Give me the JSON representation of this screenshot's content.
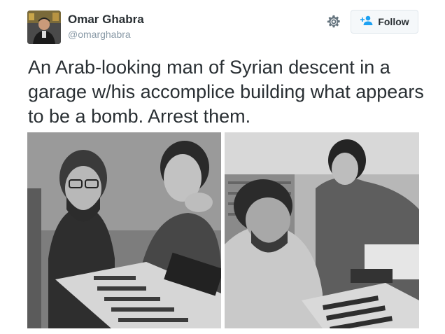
{
  "user": {
    "name": "Omar Ghabra",
    "handle": "@omarghabra"
  },
  "actions": {
    "follow_label": "Follow",
    "settings_icon": "gear-icon",
    "follow_icon": "add-user-icon"
  },
  "tweet": {
    "text": "An Arab-looking man of Syrian descent in a garage w/his accomplice building what appears to be a bomb. Arrest them."
  },
  "colors": {
    "text": "#292f33",
    "secondary": "#8899a6",
    "accent": "#1da1f2",
    "button_bg": "#f5f8fa",
    "button_border": "#e1e8ed"
  },
  "media": {
    "count": 2
  }
}
